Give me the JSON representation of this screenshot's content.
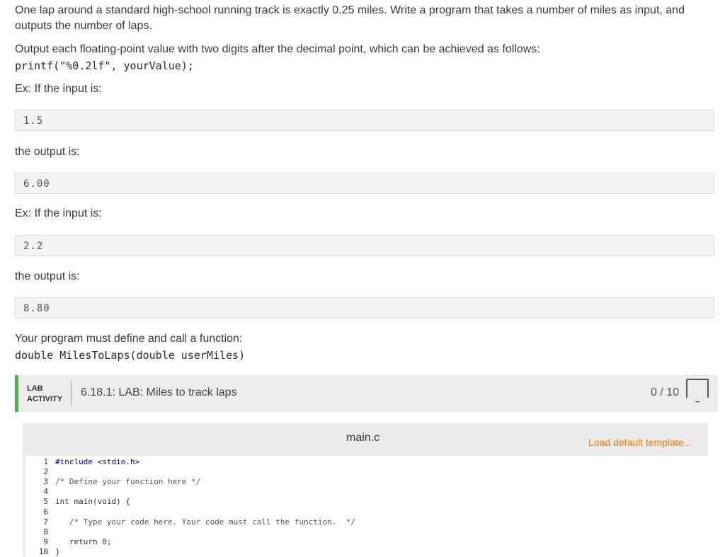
{
  "description": {
    "intro_line1": "One lap around a standard high-school running track is exactly 0.25 miles. Write a program that takes a number of miles as input, and",
    "intro_line2": "outputs the number of laps.",
    "format_note": "Output each floating-point value with two digits after the decimal point, which can be achieved as follows:",
    "format_code": "printf(\"%0.2lf\", yourValue);",
    "ex1_label": "Ex: If the input is:",
    "ex1_input": "1.5",
    "ex1_output_label": "the output is:",
    "ex1_output": "6.00",
    "ex2_label": "Ex: If the input is:",
    "ex2_input": "2.2",
    "ex2_output_label": "the output is:",
    "ex2_output": "8.80",
    "function_note": "Your program must define and call a function:",
    "function_sig": "double MilesToLaps(double userMiles)"
  },
  "lab": {
    "tag_line1": "LAB",
    "tag_line2": "ACTIVITY",
    "title": "6.18.1: LAB: Miles to track laps",
    "score": "0 / 10",
    "accent_color": "#4caf50"
  },
  "editor": {
    "file_name": "main.c",
    "load_template_label": "Load default template...",
    "link_color": "#f57c00",
    "lines": [
      {
        "n": "1",
        "text": "#include <stdio.h>"
      },
      {
        "n": "2",
        "text": ""
      },
      {
        "n": "3",
        "text": "/* Define your function here */"
      },
      {
        "n": "4",
        "text": ""
      },
      {
        "n": "5",
        "text": "int main(void) {"
      },
      {
        "n": "6",
        "text": ""
      },
      {
        "n": "7",
        "text": "   /* Type your code here. Your code must call the function.  */"
      },
      {
        "n": "8",
        "text": ""
      },
      {
        "n": "9",
        "text": "   return 0;"
      },
      {
        "n": "10",
        "text": "}"
      }
    ]
  }
}
